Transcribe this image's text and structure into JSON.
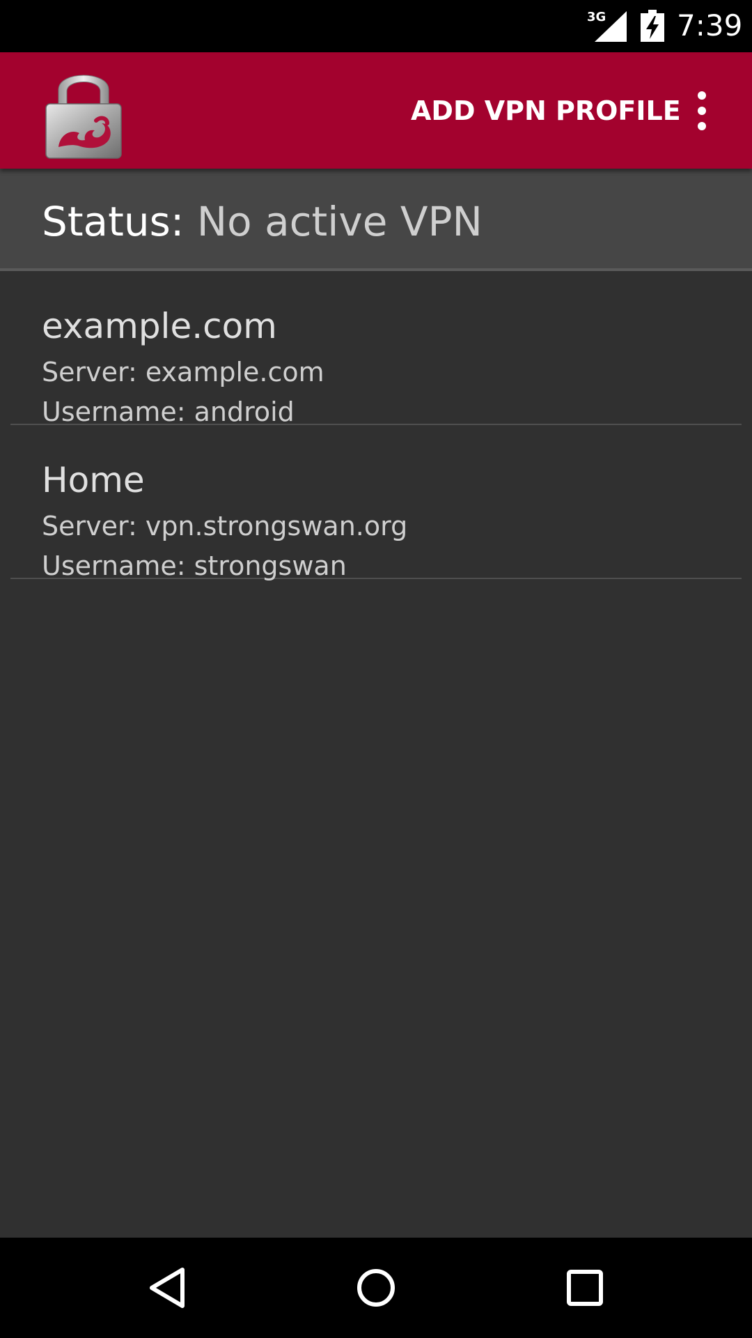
{
  "status_bar": {
    "network": "3G",
    "time": "7:39"
  },
  "toolbar": {
    "add_profile_label": "ADD VPN PROFILE",
    "logo_icon": "strongswan-lock-logo",
    "overflow_icon": "more-vert-icon",
    "background_color": "#a3022e"
  },
  "status": {
    "label": "Status:",
    "value": "No active VPN"
  },
  "profiles": [
    {
      "name": "example.com",
      "server": "Server: example.com",
      "username": "Username: android"
    },
    {
      "name": "Home",
      "server": "Server: vpn.strongswan.org",
      "username": "Username: strongswan"
    }
  ],
  "navigation": {
    "back_icon": "back-triangle-icon",
    "home_icon": "home-circle-icon",
    "recents_icon": "recents-square-icon"
  }
}
